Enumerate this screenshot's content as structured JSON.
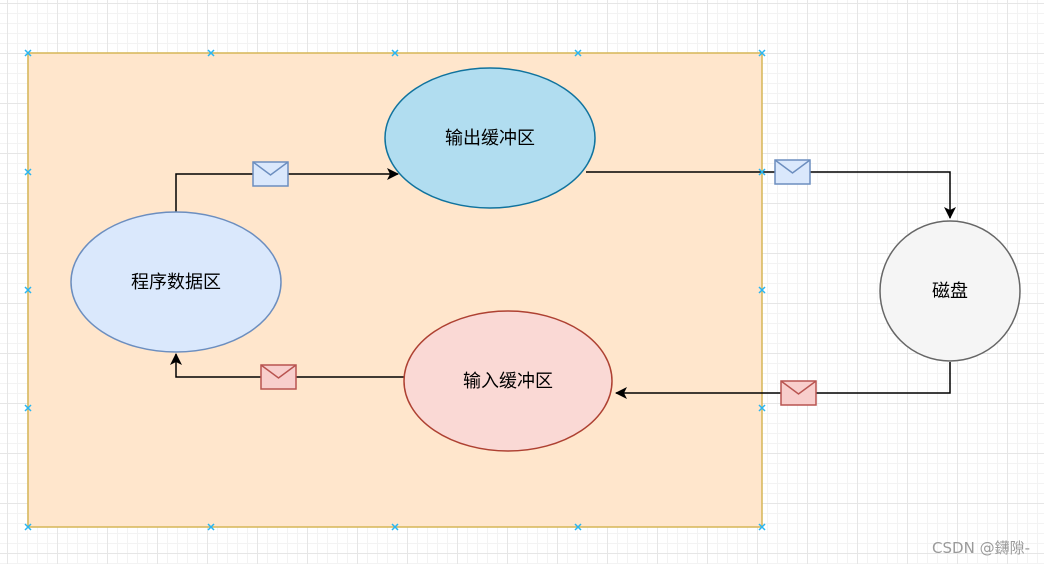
{
  "nodes": {
    "program_data": "程序数据区",
    "output_buffer": "输出缓冲区",
    "input_buffer": "输入缓冲区",
    "disk": "磁盘"
  },
  "colors": {
    "container_fill": "#ffe6cc",
    "container_border": "#d6b656",
    "program_fill": "#dae8fc",
    "program_border": "#6c8ebf",
    "output_fill": "#b1ddf0",
    "output_border": "#10739e",
    "input_fill": "#fad9d5",
    "input_border": "#ae4132",
    "disk_fill": "#f5f5f5",
    "disk_border": "#666666",
    "envelope_blue_fill": "#dae8fc",
    "envelope_blue_border": "#6c8ebf",
    "envelope_red_fill": "#f8cecc",
    "envelope_red_border": "#b85450",
    "selection_handle": "#29b6f2"
  },
  "watermark": "CSDN @鑮隙-"
}
